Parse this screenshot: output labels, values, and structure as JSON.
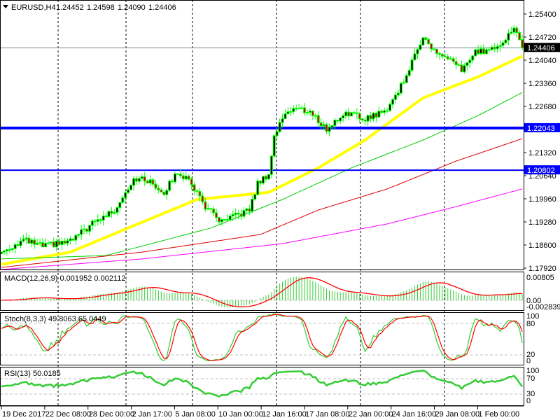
{
  "header": {
    "symbol": "EURUSD,H4",
    "open": "1.24452",
    "high": "1.24598",
    "low": "1.24090",
    "close": "1.24406"
  },
  "indicators": {
    "macd_label": "MACD(12,26,9) 0.001952 0.002112",
    "stoch_label": "Stoch(8,3,3) 49.8063 65.0449",
    "rsi_label": "RSI(13) 50.0185",
    "macd_scale": [
      "0.00805",
      "0.00",
      "-0.002839"
    ],
    "stoch_scale": [
      "100",
      "80",
      "20",
      "0"
    ],
    "rsi_scale": [
      "100",
      "70",
      "30",
      "0"
    ]
  },
  "colors": {
    "candle_outline": "#00ff00",
    "bull_body": "#000000",
    "bear_body": "#cc0000",
    "ma_yellow": "#ffff00",
    "ma_green": "#00cc00",
    "ma_red": "#dd0000",
    "ma_magenta": "#ff00ff",
    "level_line": "#0000ff",
    "price_line": "#778899"
  },
  "chart_data": {
    "type": "candlestick",
    "symbol": "EURUSD",
    "timeframe": "H4",
    "ylim": [
      1.1792,
      1.254
    ],
    "y_ticks": [
      "1.25400",
      "1.24720",
      "1.24040",
      "1.23360",
      "1.22680",
      "1.22000",
      "1.21320",
      "1.20640",
      "1.19960",
      "1.19280",
      "1.18600",
      "1.17920"
    ],
    "x_ticks": [
      "19 Dec 2017",
      "22 Dec 08:00",
      "28 Dec 00:00",
      "2 Jan 17:00",
      "5 Jan 08:00",
      "10 Jan 00:00",
      "12 Jan 16:00",
      "17 Jan 08:00",
      "22 Jan 00:00",
      "24 Jan 16:00",
      "29 Jan 08:00",
      "1 Feb 00:00"
    ],
    "candle_count": 190,
    "close_path": [
      [
        0,
        1.1839
      ],
      [
        8,
        1.1874
      ],
      [
        15,
        1.1856
      ],
      [
        25,
        1.187
      ],
      [
        33,
        1.1922
      ],
      [
        41,
        1.1963
      ],
      [
        48,
        1.2056
      ],
      [
        53,
        1.205
      ],
      [
        59,
        1.2015
      ],
      [
        64,
        1.2076
      ],
      [
        69,
        1.2041
      ],
      [
        74,
        1.1973
      ],
      [
        80,
        1.1926
      ],
      [
        87,
        1.1953
      ],
      [
        90,
        1.1963
      ],
      [
        93,
        1.2041
      ],
      [
        97,
        1.207
      ],
      [
        99,
        1.2179
      ],
      [
        103,
        1.2252
      ],
      [
        107,
        1.2262
      ],
      [
        112,
        1.2252
      ],
      [
        118,
        1.22
      ],
      [
        125,
        1.2252
      ],
      [
        131,
        1.2231
      ],
      [
        139,
        1.2252
      ],
      [
        144,
        1.2313
      ],
      [
        149,
        1.2396
      ],
      [
        153,
        1.2478
      ],
      [
        156,
        1.2437
      ],
      [
        162,
        1.2406
      ],
      [
        167,
        1.2375
      ],
      [
        172,
        1.2427
      ],
      [
        178,
        1.2437
      ],
      [
        183,
        1.2468
      ],
      [
        186,
        1.2499
      ],
      [
        189,
        1.24406
      ]
    ],
    "moving_averages": [
      {
        "name": "MA yellow",
        "color": "#ffff00",
        "points": [
          [
            0,
            1.1803
          ],
          [
            25,
            1.1839
          ],
          [
            46,
            1.191
          ],
          [
            71,
            1.1994
          ],
          [
            97,
            1.2015
          ],
          [
            115,
            1.2087
          ],
          [
            132,
            1.2169
          ],
          [
            153,
            1.2293
          ],
          [
            173,
            1.2355
          ],
          [
            189,
            1.2416
          ]
        ]
      },
      {
        "name": "MA green",
        "color": "#00cc00",
        "points": [
          [
            0,
            1.1819
          ],
          [
            38,
            1.1829
          ],
          [
            76,
            1.191
          ],
          [
            102,
            1.1994
          ],
          [
            127,
            1.2087
          ],
          [
            153,
            1.2169
          ],
          [
            173,
            1.2241
          ],
          [
            189,
            1.2309
          ]
        ]
      },
      {
        "name": "MA red",
        "color": "#dd0000",
        "points": [
          [
            0,
            1.1794
          ],
          [
            51,
            1.1839
          ],
          [
            94,
            1.1891
          ],
          [
            115,
            1.1963
          ],
          [
            140,
            1.2025
          ],
          [
            165,
            1.2107
          ],
          [
            189,
            1.2173
          ]
        ]
      },
      {
        "name": "MA magenta",
        "color": "#ff00ff",
        "points": [
          [
            0,
            1.1788
          ],
          [
            51,
            1.1819
          ],
          [
            102,
            1.1864
          ],
          [
            140,
            1.1922
          ],
          [
            165,
            1.1973
          ],
          [
            189,
            1.2025
          ]
        ]
      }
    ],
    "levels": [
      {
        "value": "1.22043",
        "color": "#0000ff",
        "thick": true
      },
      {
        "value": "1.20802",
        "color": "#0000ff",
        "thick": false
      }
    ],
    "current_price": "1.24406"
  }
}
